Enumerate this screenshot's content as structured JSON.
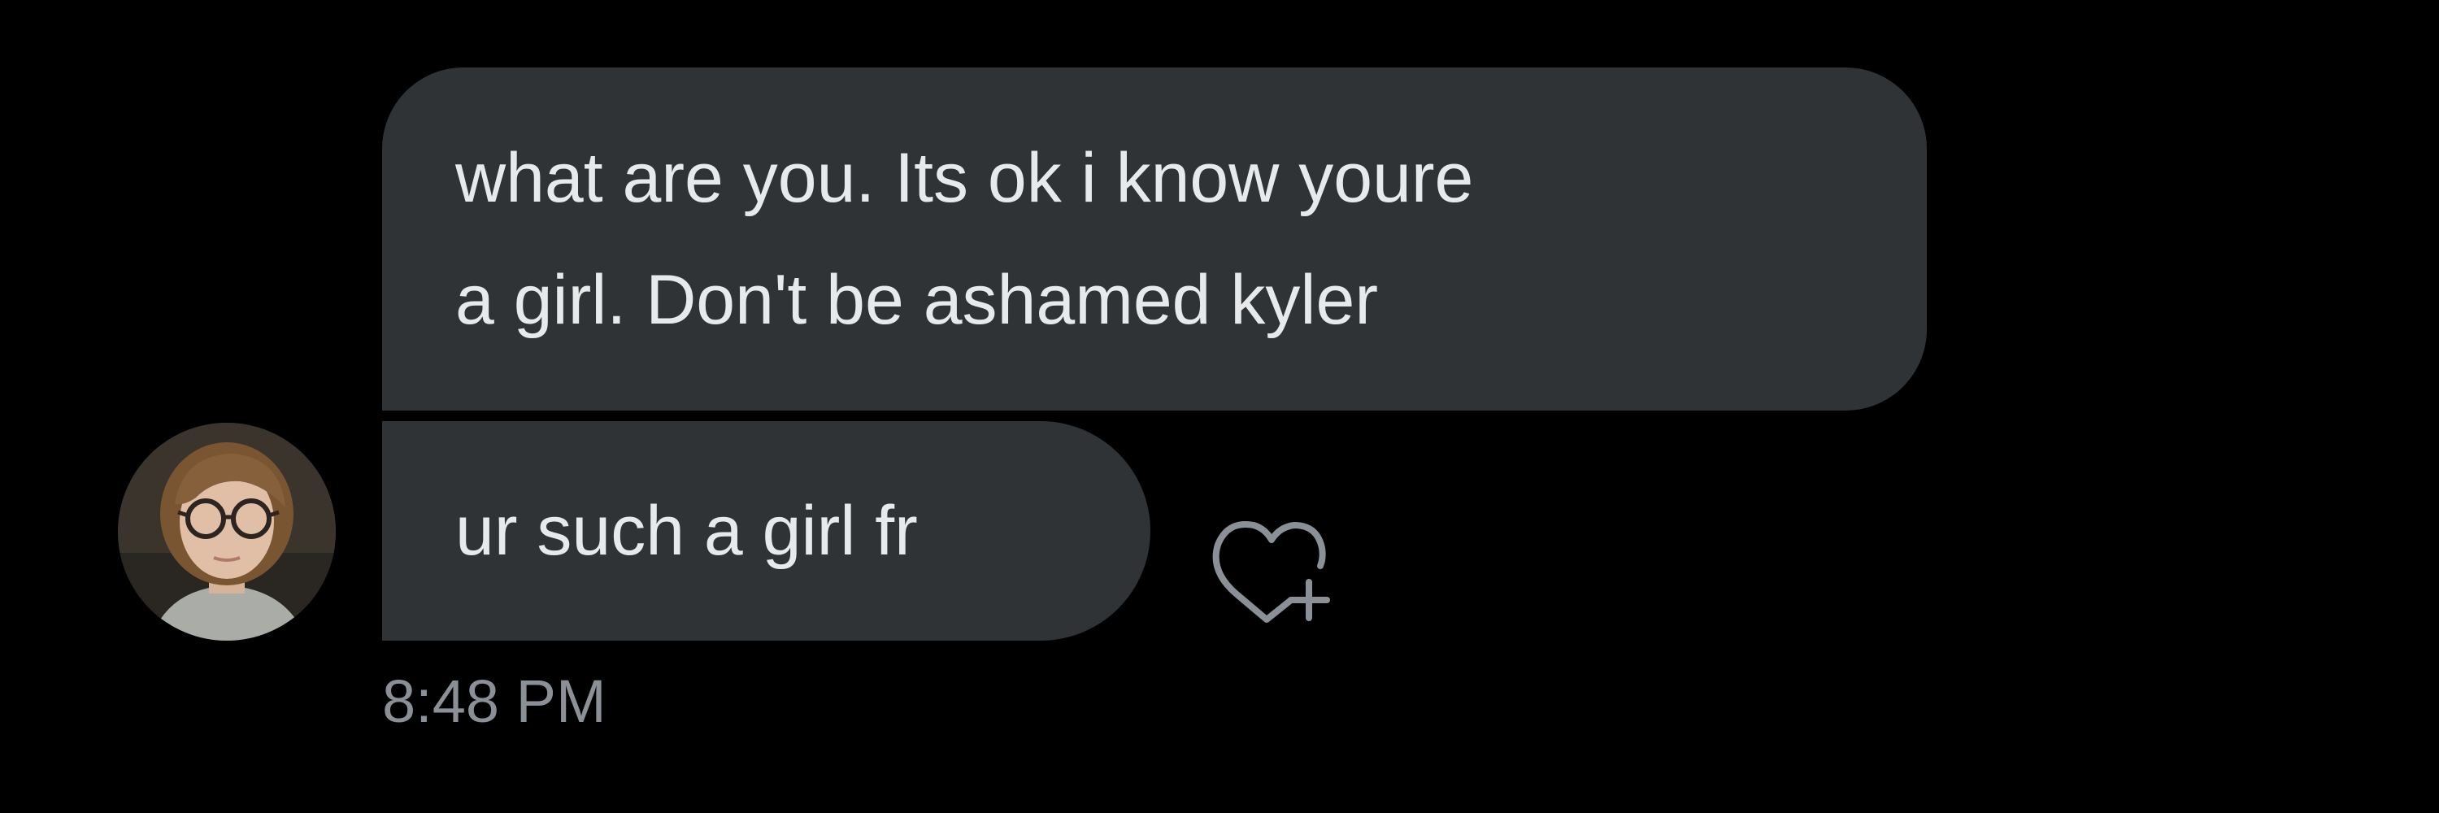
{
  "messages": [
    {
      "lines": [
        "what are you. Its ok i know youre",
        "a girl. Don't be ashamed kyler"
      ]
    },
    {
      "text": "ur such a girl fr"
    }
  ],
  "timestamp": "8:48 PM",
  "icons": {
    "avatar": "user-avatar-photo",
    "reaction": "heart-plus-icon"
  },
  "colors": {
    "background": "#000000",
    "bubble": "#2f3336",
    "message_text": "#e7e9ea",
    "timestamp_text": "#8b9096"
  }
}
